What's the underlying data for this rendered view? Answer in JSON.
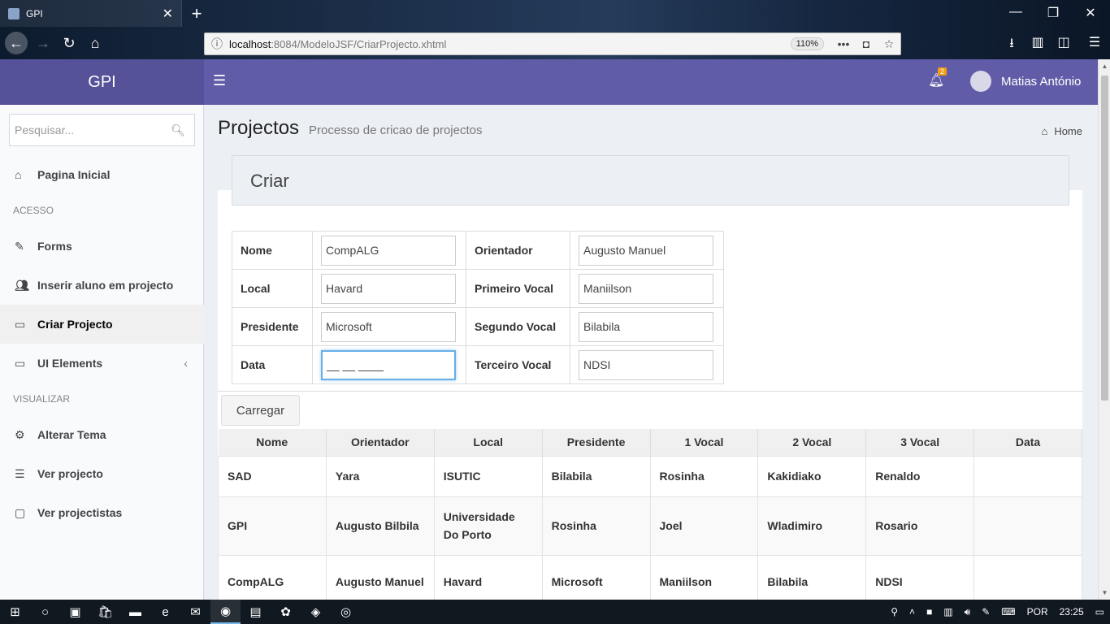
{
  "browser": {
    "tab_title": "GPI",
    "url_host": "localhost",
    "url_rest": ":8084/ModeloJSF/CriarProjecto.xhtml",
    "zoom": "110%"
  },
  "header": {
    "logo": "GPI",
    "notification_count": "2",
    "user_name": "Matias António",
    "accent_color": "#605ca8"
  },
  "sidebar": {
    "search_placeholder": "Pesquisar...",
    "items": [
      {
        "label": "Pagina Inicial",
        "icon": "home-icon"
      },
      {
        "label": "Forms",
        "icon": "edit-icon"
      },
      {
        "label": "Inserir aluno em projecto",
        "icon": "users-icon"
      },
      {
        "label": "Criar Projecto",
        "icon": "laptop-icon"
      },
      {
        "label": "UI Elements",
        "icon": "laptop-icon"
      },
      {
        "label": "Alterar Tema",
        "icon": "gears-icon"
      },
      {
        "label": "Ver projecto",
        "icon": "list-icon"
      },
      {
        "label": "Ver projectistas",
        "icon": "folder-icon"
      }
    ],
    "headers": {
      "acesso": "ACESSO",
      "visualizar": "VISUALIZAR"
    }
  },
  "page": {
    "title": "Projectos",
    "subtitle": "Processo de cricao de projectos",
    "breadcrumb": "Home",
    "box_title": "Criar"
  },
  "form": {
    "nome_label": "Nome",
    "nome_value": "CompALG",
    "local_label": "Local",
    "local_value": "Havard",
    "presidente_label": "Presidente",
    "presidente_value": "Microsoft",
    "data_label": "Data",
    "data_value": "__ __ ____",
    "orientador_label": "Orientador",
    "orientador_value": "Augusto Manuel",
    "primeiro_label": "Primeiro Vocal",
    "primeiro_value": "Maniilson",
    "segundo_label": "Segundo Vocal",
    "segundo_value": "Bilabila",
    "terceiro_label": "Terceiro Vocal",
    "terceiro_value": "NDSI",
    "submit_label": "Carregar"
  },
  "table": {
    "columns": [
      "Nome",
      "Orientador",
      "Local",
      "Presidente",
      "1 Vocal",
      "2 Vocal",
      "3 Vocal",
      "Data"
    ],
    "rows": [
      [
        "SAD",
        "Yara",
        "ISUTIC",
        "Bilabila",
        "Rosinha",
        "Kakidiako",
        "Renaldo",
        ""
      ],
      [
        "GPI",
        "Augusto Bilbila",
        "Universidade Do Porto",
        "Rosinha",
        "Joel",
        "Wladimiro",
        "Rosario",
        ""
      ],
      [
        "CompALG",
        "Augusto Manuel",
        "Havard",
        "Microsoft",
        "Maniilson",
        "Bilabila",
        "NDSI",
        ""
      ]
    ]
  },
  "taskbar": {
    "language": "POR",
    "time": "23:25"
  }
}
